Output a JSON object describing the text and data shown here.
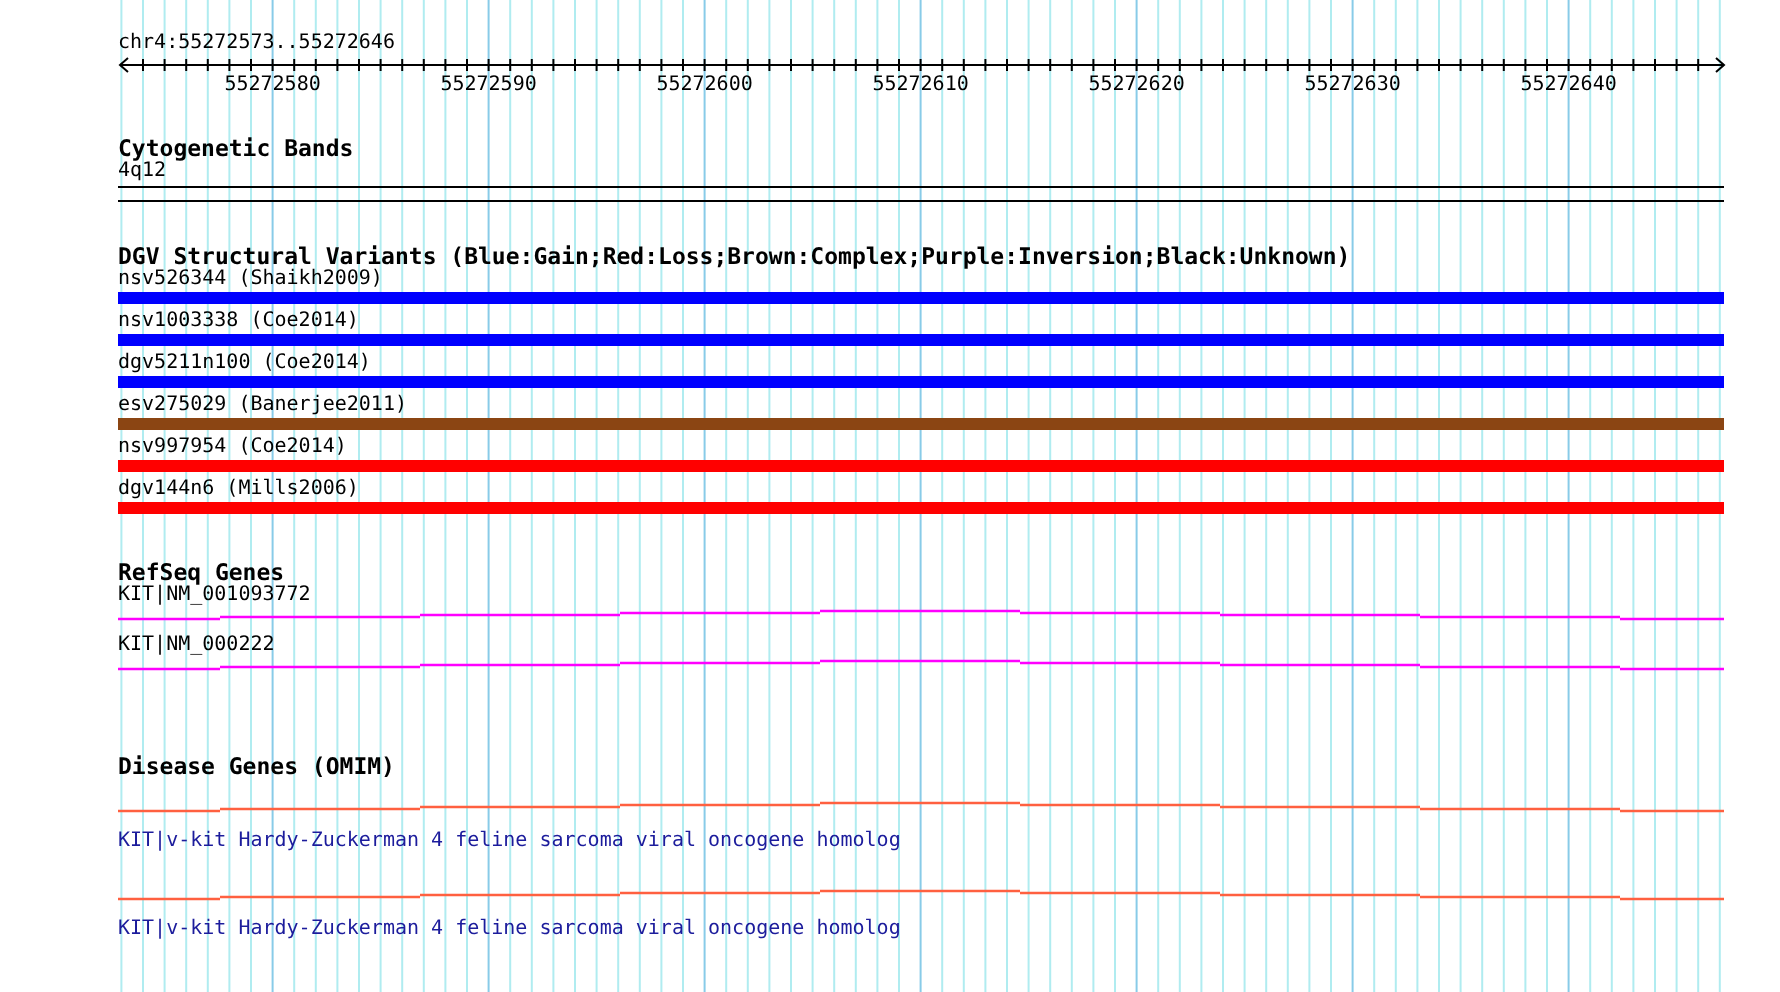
{
  "ruler": {
    "range": "chr4:55272573..55272646",
    "tick_labels": [
      "55272580",
      "55272590",
      "55272600",
      "55272610",
      "55272620",
      "55272630",
      "55272640"
    ]
  },
  "tracks": [
    {
      "kind": "bands",
      "title": "Cytogenetic Bands",
      "features": [
        {
          "label": "4q12"
        }
      ]
    },
    {
      "kind": "variants",
      "title": "DGV Structural Variants (Blue:Gain;Red:Loss;Brown:Complex;Purple:Inversion;Black:Unknown)",
      "features": [
        {
          "label": "nsv526344 (Shaikh2009)",
          "color": "#0000ff"
        },
        {
          "label": "nsv1003338 (Coe2014)",
          "color": "#0000ff"
        },
        {
          "label": "dgv5211n100 (Coe2014)",
          "color": "#0000ff"
        },
        {
          "label": "esv275029 (Banerjee2011)",
          "color": "#8b4513"
        },
        {
          "label": "nsv997954 (Coe2014)",
          "color": "#ff0000"
        },
        {
          "label": "dgv144n6 (Mills2006)",
          "color": "#ff0000"
        }
      ]
    },
    {
      "kind": "genes",
      "title": "RefSeq Genes",
      "features": [
        {
          "label": "KIT|NM_001093772"
        },
        {
          "label": "KIT|NM_000222"
        }
      ]
    },
    {
      "kind": "disease",
      "title": "Disease Genes (OMIM)",
      "features": [
        {
          "label": "KIT|v-kit Hardy-Zuckerman 4 feline sarcoma viral oncogene homolog"
        },
        {
          "label": "KIT|v-kit Hardy-Zuckerman 4 feline sarcoma viral oncogene homolog"
        }
      ]
    }
  ]
}
